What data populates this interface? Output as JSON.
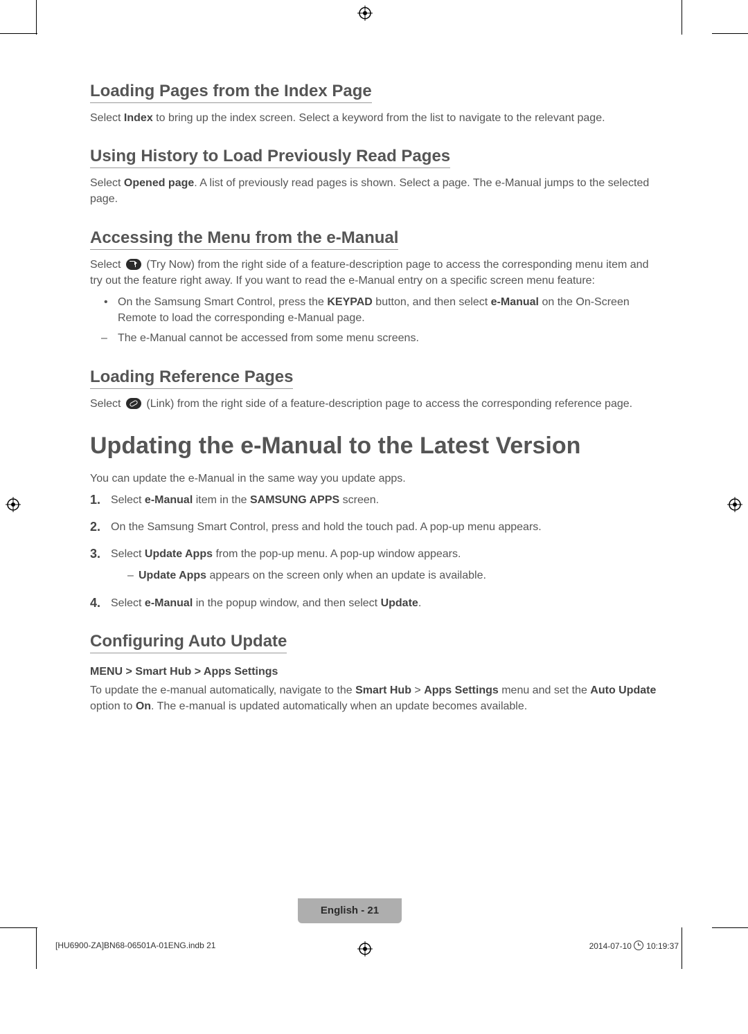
{
  "sections": {
    "s1": {
      "title": "Loading Pages from the Index Page",
      "p1a": "Select ",
      "p1b": "Index",
      "p1c": " to bring up the index screen. Select a keyword from the list to navigate to the relevant page."
    },
    "s2": {
      "title": "Using History to Load Previously Read Pages",
      "p1a": "Select ",
      "p1b": "Opened page",
      "p1c": ". A list of previously read pages is shown. Select a page. The e-Manual jumps to the selected page."
    },
    "s3": {
      "title": "Accessing the Menu from the e-Manual",
      "p1a": "Select ",
      "p1b": " (Try Now) from the right side of a feature-description page to access the corresponding menu item and try out the feature right away. If you want to read the e-Manual entry on a specific screen menu feature:",
      "b1a": "On the Samsung Smart Control, press the ",
      "b1b": "KEYPAD",
      "b1c": " button, and then select ",
      "b1d": "e-Manual",
      "b1e": " on the On-Screen Remote to load the corresponding e-Manual page.",
      "b2": "The e-Manual cannot be accessed from some menu screens."
    },
    "s4": {
      "title": "Loading Reference Pages",
      "p1a": "Select ",
      "p1b": " (Link) from the right side of a feature-description page to access the corresponding reference page."
    },
    "s5": {
      "title": "Updating the e-Manual to the Latest Version",
      "p1": "You can update the e-Manual in the same way you update apps.",
      "o1a": "Select ",
      "o1b": "e-Manual",
      "o1c": " item in the ",
      "o1d": "SAMSUNG APPS",
      "o1e": " screen.",
      "o2": "On the Samsung Smart Control, press and hold the touch pad. A pop-up menu appears.",
      "o3a": "Select ",
      "o3b": "Update Apps",
      "o3c": " from the pop-up menu. A pop-up window appears.",
      "o3sub_a": "Update Apps",
      "o3sub_b": " appears on the screen only when an update is available.",
      "o4a": "Select ",
      "o4b": "e-Manual",
      "o4c": " in the popup window, and then select ",
      "o4d": "Update",
      "o4e": "."
    },
    "s6": {
      "title": "Configuring Auto Update",
      "path": "MENU > Smart Hub > Apps Settings",
      "p1a": "To update the e-manual automatically, navigate to the ",
      "p1b": "Smart Hub",
      "p1c": " > ",
      "p1d": "Apps Settings",
      "p1e": " menu and set the ",
      "p1f": "Auto Update",
      "p1g": " option to ",
      "p1h": "On",
      "p1i": ". The e-manual is updated automatically when an update becomes available."
    }
  },
  "footer": {
    "page_label": "English - 21",
    "left": "[HU6900-ZA]BN68-06501A-01ENG.indb   21",
    "right_date": "2014-07-10   ",
    "right_time": "10:19:37"
  }
}
